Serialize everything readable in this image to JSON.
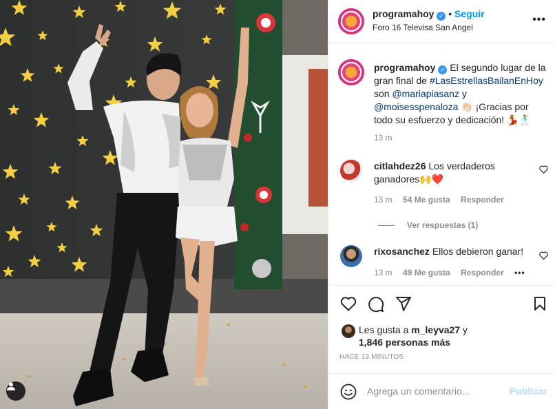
{
  "post": {
    "username": "programahoy",
    "follow_label": "Seguir",
    "location": "Foro 16 Televisa San Angel",
    "more_icon": "more-horizontal-icon"
  },
  "caption": {
    "username": "programahoy",
    "text_1": "El segundo lugar de la gran final de",
    "hashtag": "#LasEstrellasBailanEnHoy",
    "text_2": "son",
    "mention_1": "@mariapiasanz",
    "text_3": "y",
    "mention_2": "@moisesspenaloza",
    "text_4": "👏🏻 ¡Gracias por todo su esfuerzo y dedicación! 💃🕺",
    "time": "13 m"
  },
  "comments": [
    {
      "username": "citlahdez26",
      "text": "Los verdaderos ganadores🙌❤️",
      "time": "13 m",
      "likes": "54 Me gusta",
      "reply_label": "Responder",
      "view_replies": "Ver respuestas (1)"
    },
    {
      "username": "rixosanchez",
      "text": "Ellos debieron ganar!",
      "time": "13 m",
      "likes": "49 Me gusta",
      "reply_label": "Responder",
      "options": "•••"
    }
  ],
  "likes": {
    "prefix": "Les gusta a",
    "user": "m_leyva27",
    "conjunction": "y",
    "others": "1,846 personas más"
  },
  "posted_ago": "HACE 13 MINUTOS",
  "comment_box": {
    "placeholder": "Agrega un comentario...",
    "publish_label": "Publicar"
  },
  "colors": {
    "link_blue": "#0095f6",
    "mention_blue": "#00376b",
    "muted_grey": "#8e8e8e",
    "publish_disabled": "#b2dffc",
    "star_yellow": "#f4cf43"
  }
}
